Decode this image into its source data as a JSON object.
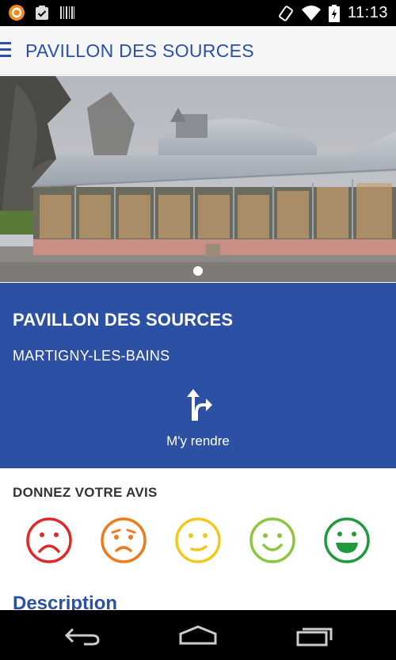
{
  "status_bar": {
    "time": "11:13",
    "left_icons": [
      "app-notification-icon",
      "clipboard-check-icon",
      "barcode-icon"
    ],
    "right_icons": [
      "rotate-icon",
      "wifi-icon",
      "battery-charging-icon"
    ]
  },
  "app_bar": {
    "title": "PAVILLON DES SOURCES",
    "menu_icon": "hamburger-menu-icon"
  },
  "hero": {
    "image_description": "Pavillon des Sources glass pavilion",
    "page_indicator_count": 1,
    "page_indicator_active": 1
  },
  "info": {
    "title": "PAVILLON DES SOURCES",
    "city": "MARTIGNY-LES-BAINS",
    "directions_label": "M'y rendre",
    "accent": "#2b50a4"
  },
  "rating": {
    "title": "DONNEZ VOTRE AVIS",
    "options": [
      {
        "name": "very-unhappy",
        "color": "#e02828"
      },
      {
        "name": "unhappy",
        "color": "#ef7a1a"
      },
      {
        "name": "neutral",
        "color": "#f2c81c"
      },
      {
        "name": "happy",
        "color": "#8cc63e"
      },
      {
        "name": "very-happy",
        "color": "#1e9a3c"
      }
    ]
  },
  "description": {
    "heading": "Description"
  },
  "nav_bar": {
    "icons": [
      "back-icon",
      "home-icon",
      "recent-apps-icon"
    ]
  }
}
